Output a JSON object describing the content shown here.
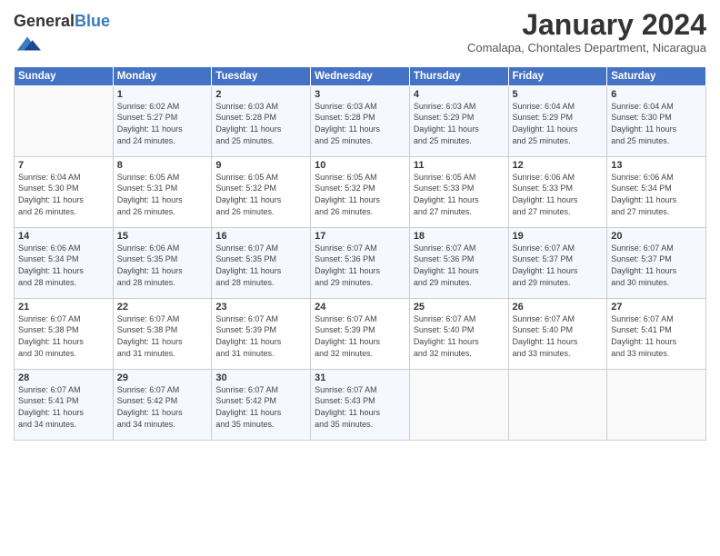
{
  "logo": {
    "general": "General",
    "blue": "Blue"
  },
  "title": "January 2024",
  "subtitle": "Comalapa, Chontales Department, Nicaragua",
  "header_days": [
    "Sunday",
    "Monday",
    "Tuesday",
    "Wednesday",
    "Thursday",
    "Friday",
    "Saturday"
  ],
  "weeks": [
    [
      {
        "day": "",
        "info": ""
      },
      {
        "day": "1",
        "info": "Sunrise: 6:02 AM\nSunset: 5:27 PM\nDaylight: 11 hours\nand 24 minutes."
      },
      {
        "day": "2",
        "info": "Sunrise: 6:03 AM\nSunset: 5:28 PM\nDaylight: 11 hours\nand 25 minutes."
      },
      {
        "day": "3",
        "info": "Sunrise: 6:03 AM\nSunset: 5:28 PM\nDaylight: 11 hours\nand 25 minutes."
      },
      {
        "day": "4",
        "info": "Sunrise: 6:03 AM\nSunset: 5:29 PM\nDaylight: 11 hours\nand 25 minutes."
      },
      {
        "day": "5",
        "info": "Sunrise: 6:04 AM\nSunset: 5:29 PM\nDaylight: 11 hours\nand 25 minutes."
      },
      {
        "day": "6",
        "info": "Sunrise: 6:04 AM\nSunset: 5:30 PM\nDaylight: 11 hours\nand 25 minutes."
      }
    ],
    [
      {
        "day": "7",
        "info": "Sunrise: 6:04 AM\nSunset: 5:30 PM\nDaylight: 11 hours\nand 26 minutes."
      },
      {
        "day": "8",
        "info": "Sunrise: 6:05 AM\nSunset: 5:31 PM\nDaylight: 11 hours\nand 26 minutes."
      },
      {
        "day": "9",
        "info": "Sunrise: 6:05 AM\nSunset: 5:32 PM\nDaylight: 11 hours\nand 26 minutes."
      },
      {
        "day": "10",
        "info": "Sunrise: 6:05 AM\nSunset: 5:32 PM\nDaylight: 11 hours\nand 26 minutes."
      },
      {
        "day": "11",
        "info": "Sunrise: 6:05 AM\nSunset: 5:33 PM\nDaylight: 11 hours\nand 27 minutes."
      },
      {
        "day": "12",
        "info": "Sunrise: 6:06 AM\nSunset: 5:33 PM\nDaylight: 11 hours\nand 27 minutes."
      },
      {
        "day": "13",
        "info": "Sunrise: 6:06 AM\nSunset: 5:34 PM\nDaylight: 11 hours\nand 27 minutes."
      }
    ],
    [
      {
        "day": "14",
        "info": "Sunrise: 6:06 AM\nSunset: 5:34 PM\nDaylight: 11 hours\nand 28 minutes."
      },
      {
        "day": "15",
        "info": "Sunrise: 6:06 AM\nSunset: 5:35 PM\nDaylight: 11 hours\nand 28 minutes."
      },
      {
        "day": "16",
        "info": "Sunrise: 6:07 AM\nSunset: 5:35 PM\nDaylight: 11 hours\nand 28 minutes."
      },
      {
        "day": "17",
        "info": "Sunrise: 6:07 AM\nSunset: 5:36 PM\nDaylight: 11 hours\nand 29 minutes."
      },
      {
        "day": "18",
        "info": "Sunrise: 6:07 AM\nSunset: 5:36 PM\nDaylight: 11 hours\nand 29 minutes."
      },
      {
        "day": "19",
        "info": "Sunrise: 6:07 AM\nSunset: 5:37 PM\nDaylight: 11 hours\nand 29 minutes."
      },
      {
        "day": "20",
        "info": "Sunrise: 6:07 AM\nSunset: 5:37 PM\nDaylight: 11 hours\nand 30 minutes."
      }
    ],
    [
      {
        "day": "21",
        "info": "Sunrise: 6:07 AM\nSunset: 5:38 PM\nDaylight: 11 hours\nand 30 minutes."
      },
      {
        "day": "22",
        "info": "Sunrise: 6:07 AM\nSunset: 5:38 PM\nDaylight: 11 hours\nand 31 minutes."
      },
      {
        "day": "23",
        "info": "Sunrise: 6:07 AM\nSunset: 5:39 PM\nDaylight: 11 hours\nand 31 minutes."
      },
      {
        "day": "24",
        "info": "Sunrise: 6:07 AM\nSunset: 5:39 PM\nDaylight: 11 hours\nand 32 minutes."
      },
      {
        "day": "25",
        "info": "Sunrise: 6:07 AM\nSunset: 5:40 PM\nDaylight: 11 hours\nand 32 minutes."
      },
      {
        "day": "26",
        "info": "Sunrise: 6:07 AM\nSunset: 5:40 PM\nDaylight: 11 hours\nand 33 minutes."
      },
      {
        "day": "27",
        "info": "Sunrise: 6:07 AM\nSunset: 5:41 PM\nDaylight: 11 hours\nand 33 minutes."
      }
    ],
    [
      {
        "day": "28",
        "info": "Sunrise: 6:07 AM\nSunset: 5:41 PM\nDaylight: 11 hours\nand 34 minutes."
      },
      {
        "day": "29",
        "info": "Sunrise: 6:07 AM\nSunset: 5:42 PM\nDaylight: 11 hours\nand 34 minutes."
      },
      {
        "day": "30",
        "info": "Sunrise: 6:07 AM\nSunset: 5:42 PM\nDaylight: 11 hours\nand 35 minutes."
      },
      {
        "day": "31",
        "info": "Sunrise: 6:07 AM\nSunset: 5:43 PM\nDaylight: 11 hours\nand 35 minutes."
      },
      {
        "day": "",
        "info": ""
      },
      {
        "day": "",
        "info": ""
      },
      {
        "day": "",
        "info": ""
      }
    ]
  ]
}
